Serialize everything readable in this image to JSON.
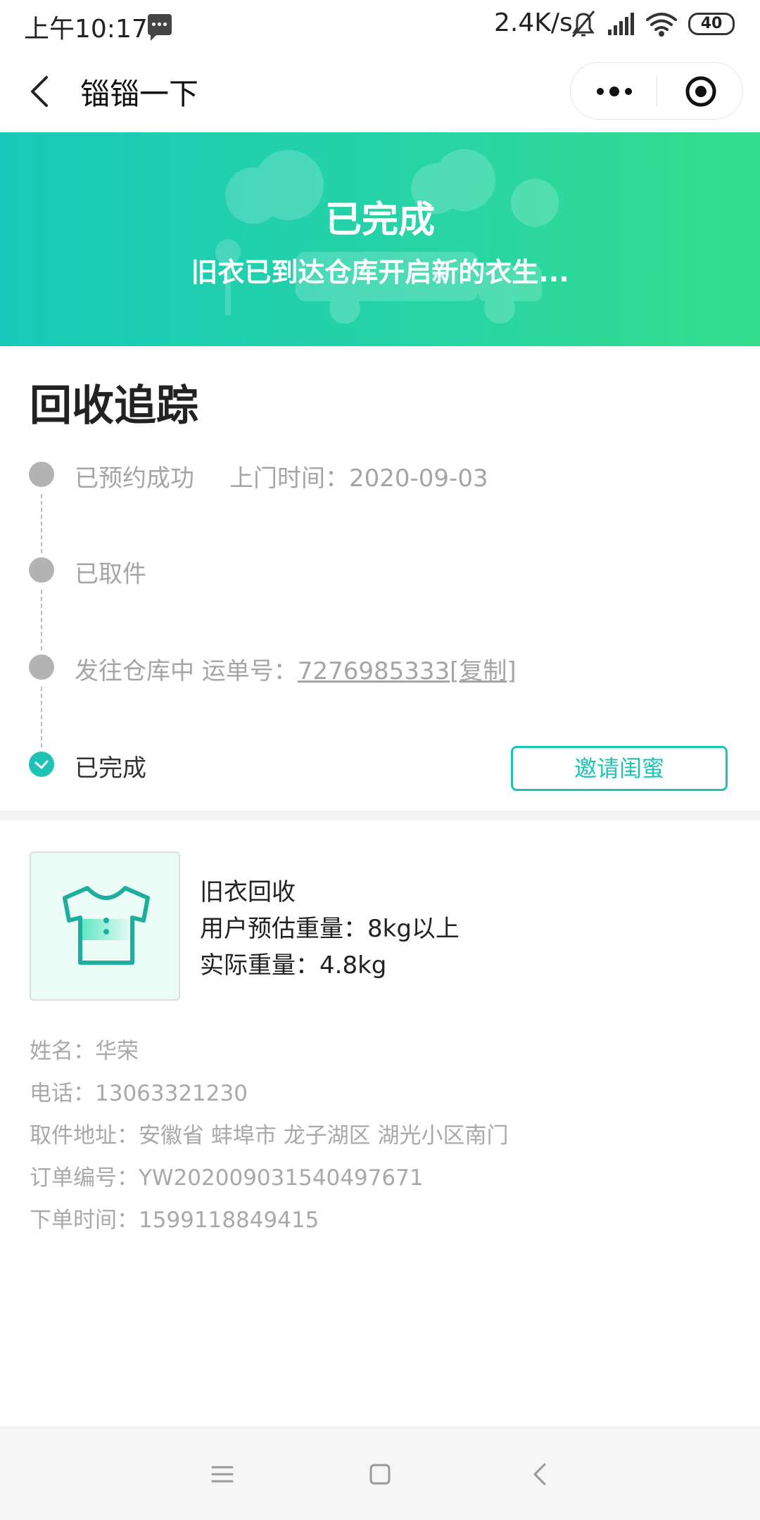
{
  "status_bar": {
    "time": "上午10:17",
    "net_speed": "2.4K/s",
    "battery": "40"
  },
  "nav": {
    "title": "锱锱一下"
  },
  "banner": {
    "title": "已完成",
    "subtitle": "旧衣已到达仓库开启新的衣生..."
  },
  "tracking": {
    "title": "回收追踪",
    "steps": [
      {
        "label": "已预约成功",
        "extra": "上门时间：2020-09-03"
      },
      {
        "label": "已取件"
      },
      {
        "label": "发往仓库中",
        "waybill_prefix": "运单号：",
        "waybill_no": "7276985333",
        "copy_label": "[复制]"
      },
      {
        "label": "已完成"
      }
    ],
    "invite_label": "邀请闺蜜"
  },
  "order": {
    "product_name": "旧衣回收",
    "estimated_weight": "用户预估重量：8kg以上",
    "actual_weight": "实际重量：4.8kg",
    "name": "姓名：华荣",
    "phone": "电话：13063321230",
    "address": "取件地址：安徽省 蚌埠市 龙子湖区 湖光小区南门",
    "order_no": "订单编号：YW202009031540497671",
    "order_time": "下单时间：1599118849415"
  },
  "colors": {
    "accent": "#1dc3b5",
    "banner_start": "#17c9b8",
    "banner_end": "#33dd8c"
  }
}
